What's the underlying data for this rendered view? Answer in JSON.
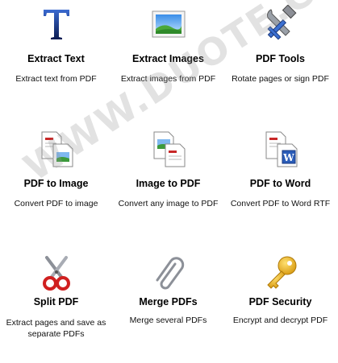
{
  "tiles": [
    {
      "name": "extract-text",
      "icon": "text-T-icon",
      "title": "Extract Text",
      "desc": "Extract text from PDF"
    },
    {
      "name": "extract-images",
      "icon": "image-landscape-icon",
      "title": "Extract Images",
      "desc": "Extract images from PDF"
    },
    {
      "name": "pdf-tools",
      "icon": "tools-wrench-hammer-icon",
      "title": "PDF Tools",
      "desc": "Rotate pages or sign PDF"
    },
    {
      "name": "pdf-to-image",
      "icon": "pdf-to-image-icon",
      "title": "PDF to Image",
      "desc": "Convert PDF to image"
    },
    {
      "name": "image-to-pdf",
      "icon": "image-to-pdf-icon",
      "title": "Image to PDF",
      "desc": "Convert any image to PDF"
    },
    {
      "name": "pdf-to-word",
      "icon": "pdf-to-word-icon",
      "title": "PDF to Word",
      "desc": "Convert PDF to Word RTF"
    },
    {
      "name": "split-pdf",
      "icon": "scissors-icon",
      "title": "Split PDF",
      "desc": "Extract pages and save as separate PDFs"
    },
    {
      "name": "merge-pdfs",
      "icon": "paperclip-icon",
      "title": "Merge PDFs",
      "desc": "Merge several PDFs"
    },
    {
      "name": "pdf-security",
      "icon": "key-icon",
      "title": "PDF Security",
      "desc": "Encrypt and decrypt PDF"
    }
  ],
  "watermark": "WWW.DUOTE.COM",
  "colors": {
    "text_icon": "#1a3a8a",
    "key": "#e8b020",
    "scissors": "#d02020",
    "word": "#2a5cb8"
  }
}
